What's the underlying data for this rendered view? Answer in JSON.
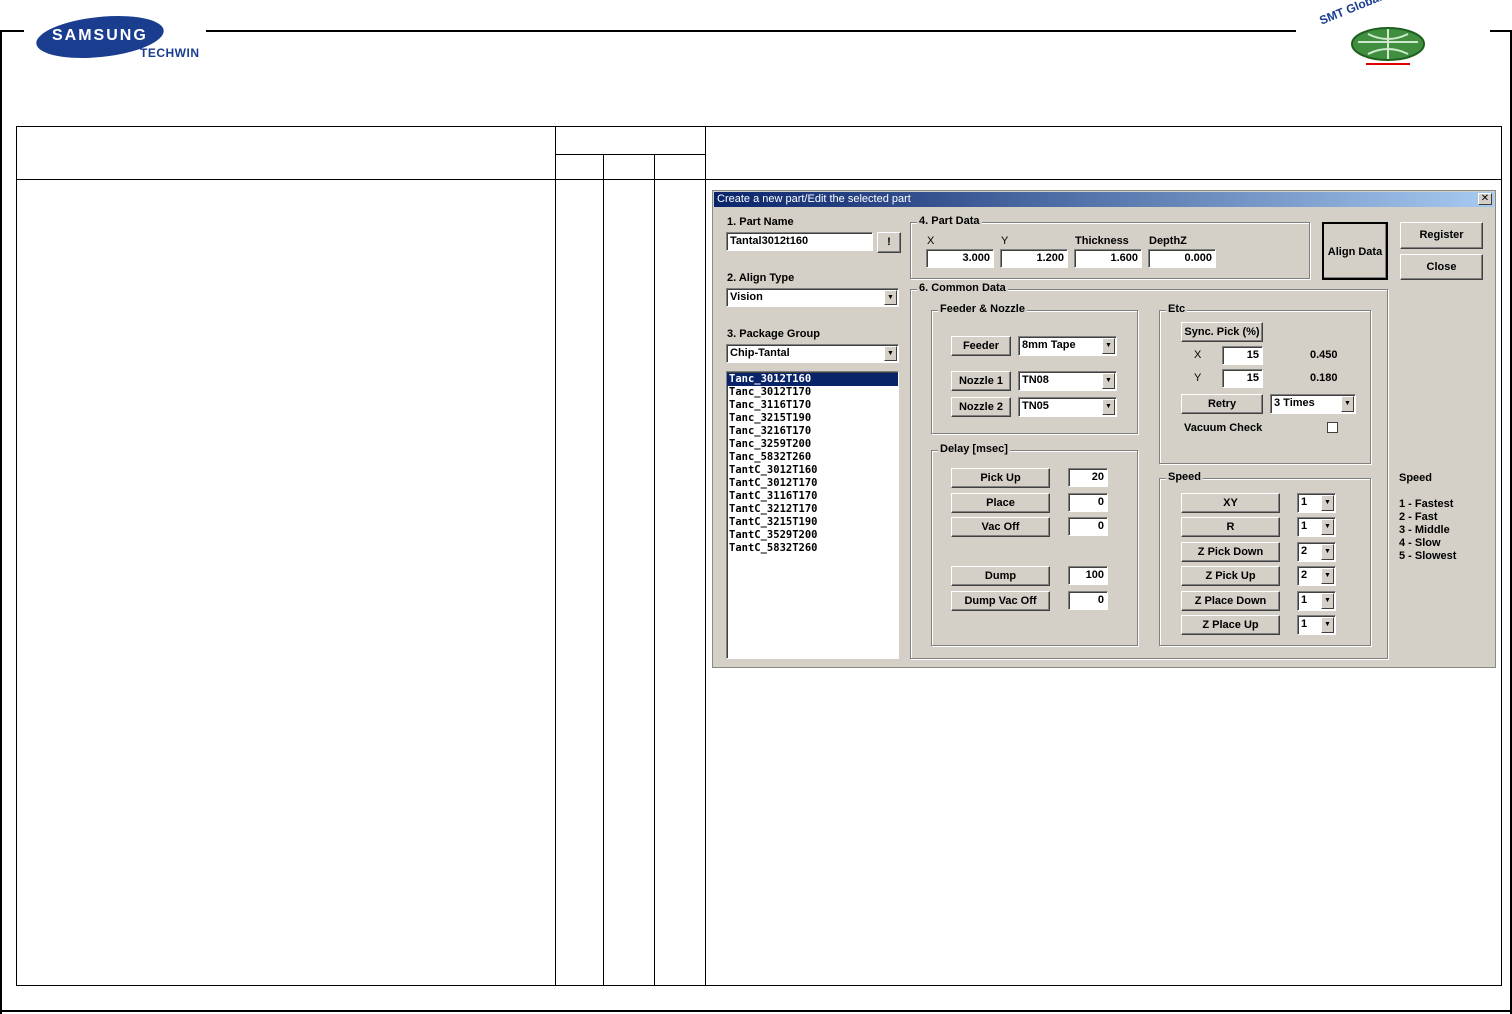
{
  "header": {
    "brand": "SAMSUNG",
    "sub_brand": "TECHWIN",
    "right_logo": "SMT Global Training Center"
  },
  "dialog": {
    "title": "Create a new part/Edit the selected part",
    "close_glyph": "✕",
    "part_name": {
      "label": "1. Part Name",
      "value": "Tantal3012t160",
      "button": "!"
    },
    "align_type": {
      "label": "2. Align Type",
      "value": "Vision"
    },
    "package_group": {
      "label": "3. Package Group",
      "value": "Chip-Tantal"
    },
    "package_list": [
      "Tanc_3012T160",
      "Tanc_3012T170",
      "Tanc_3116T170",
      "Tanc_3215T190",
      "Tanc_3216T170",
      "Tanc_3259T200",
      "Tanc_5832T260",
      "TantC_3012T160",
      "TantC_3012T170",
      "TantC_3116T170",
      "TantC_3212T170",
      "TantC_3215T190",
      "TantC_3529T200",
      "TantC_5832T260"
    ],
    "selected_index": 0,
    "part_data": {
      "title": "4. Part Data",
      "x_label": "X",
      "x": "3.000",
      "y_label": "Y",
      "y": "1.200",
      "thickness_label": "Thickness",
      "thickness": "1.600",
      "depth_label": "DepthZ",
      "depth": "0.000"
    },
    "align_data_button": "Align Data",
    "register_button": "Register",
    "close_button": "Close",
    "common_data": {
      "title": "6. Common Data",
      "feeder_nozzle": {
        "title": "Feeder & Nozzle",
        "feeder_label": "Feeder",
        "feeder_value": "8mm Tape",
        "nozzle1_label": "Nozzle 1",
        "nozzle1_value": "TN08",
        "nozzle2_label": "Nozzle 2",
        "nozzle2_value": "TN05"
      },
      "etc": {
        "title": "Etc",
        "sync_pick_label": "Sync. Pick (%)",
        "x_label": "X",
        "x_value": "15",
        "x_result": "0.450",
        "y_label": "Y",
        "y_value": "15",
        "y_result": "0.180",
        "retry_label": "Retry",
        "retry_value": "3 Times",
        "vacuum_label": "Vacuum Check"
      },
      "delay": {
        "title": "Delay [msec]",
        "pick_up_label": "Pick Up",
        "pick_up": "20",
        "place_label": "Place",
        "place": "0",
        "vac_off_label": "Vac Off",
        "vac_off": "0",
        "dump_label": "Dump",
        "dump": "100",
        "dump_vac_off_label": "Dump Vac Off",
        "dump_vac_off": "0"
      },
      "speed": {
        "title": "Speed",
        "xy_label": "XY",
        "xy": "1",
        "r_label": "R",
        "r": "1",
        "z_pick_down_label": "Z Pick Down",
        "z_pick_down": "2",
        "z_pick_up_label": "Z Pick Up",
        "z_pick_up": "2",
        "z_place_down_label": "Z Place Down",
        "z_place_down": "1",
        "z_place_up_label": "Z Place Up",
        "z_place_up": "1"
      }
    },
    "speed_legend": {
      "title": "Speed",
      "items": [
        "1 - Fastest",
        "2 - Fast",
        "3 - Middle",
        "4 - Slow",
        "5 - Slowest"
      ]
    }
  }
}
